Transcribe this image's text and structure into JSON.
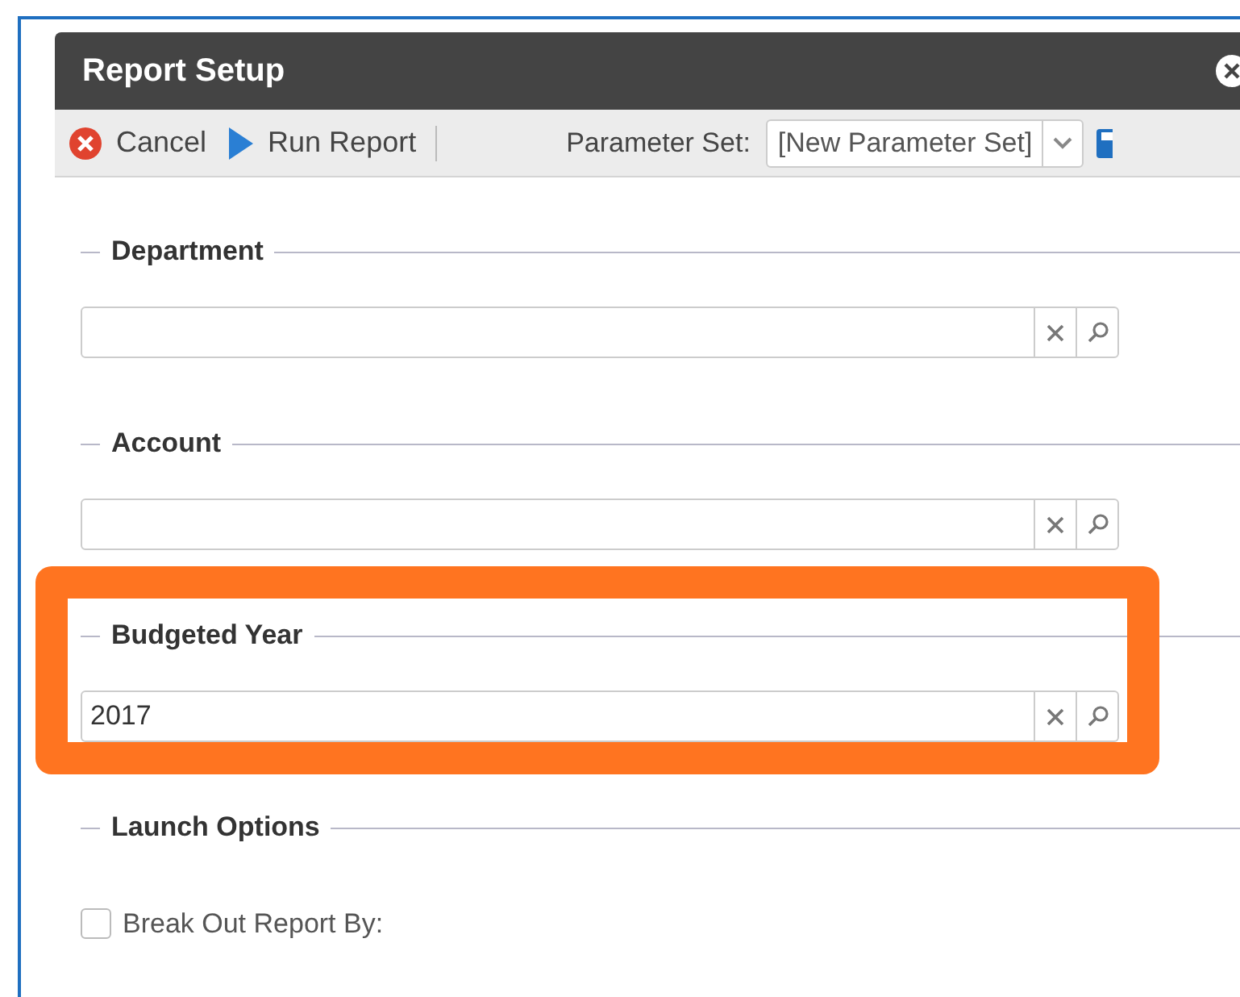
{
  "window": {
    "title": "Report Setup"
  },
  "toolbar": {
    "buttons": [
      {
        "label": "Cancel",
        "kind": "cancel"
      },
      {
        "label": "Run Report",
        "kind": "run"
      }
    ],
    "parameter_set": {
      "label": "Parameter Set:",
      "value": "[New Parameter Set]"
    }
  },
  "sections": [
    {
      "kind": "lookup",
      "title": "Department",
      "highlighted": false
    },
    {
      "kind": "lookup",
      "title": "Account",
      "highlighted": false
    },
    {
      "kind": "lookup",
      "title": "Budgeted Year",
      "highlighted": true,
      "value": "2017"
    },
    {
      "kind": "options",
      "title": "Launch Options",
      "highlighted": false,
      "options": [
        {
          "label": "Break Out Report By:",
          "checked": false
        }
      ]
    }
  ]
}
